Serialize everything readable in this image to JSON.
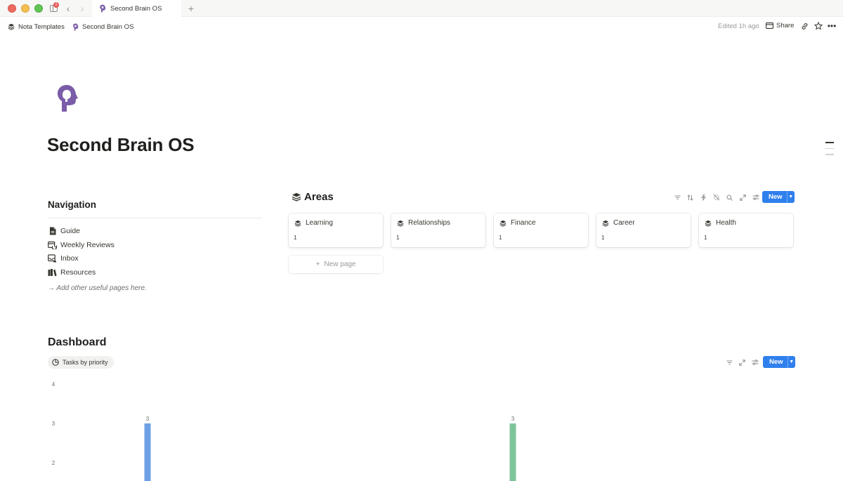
{
  "browser": {
    "tab_title": "Second Brain OS",
    "notification_count": "2"
  },
  "topbar": {
    "breadcrumbs": [
      {
        "label": "Nota Templates",
        "icon": "stack-icon"
      },
      {
        "label": "Second Brain OS",
        "icon": "brain-head-icon"
      }
    ],
    "edited": "Edited 1h ago",
    "share_label": "Share"
  },
  "page": {
    "title": "Second Brain OS",
    "icon": "brain-head-icon",
    "icon_color": "#7b5ca8"
  },
  "navigation": {
    "heading": "Navigation",
    "items": [
      {
        "label": "Guide",
        "icon": "document-icon"
      },
      {
        "label": "Weekly Reviews",
        "icon": "calendar-sync-icon"
      },
      {
        "label": "Inbox",
        "icon": "inbox-icon"
      },
      {
        "label": "Resources",
        "icon": "books-icon"
      }
    ],
    "hint": "→ Add other useful pages here."
  },
  "areas": {
    "heading": "Areas",
    "new_label": "New",
    "cards": [
      {
        "title": "Learning",
        "count": "1"
      },
      {
        "title": "Relationships",
        "count": "1"
      },
      {
        "title": "Finance",
        "count": "1"
      },
      {
        "title": "Career",
        "count": "1"
      },
      {
        "title": "Health",
        "count": "1"
      }
    ],
    "new_page_label": "New page"
  },
  "dashboard": {
    "heading": "Dashboard",
    "view_tab": "Tasks by priority",
    "new_label": "New"
  },
  "colors": {
    "accent": "#2f80ed",
    "bar_blue": "#6ea0e6",
    "bar_green": "#7ec49a"
  },
  "chart_data": {
    "type": "bar",
    "categories": [
      "",
      ""
    ],
    "values": [
      3,
      3
    ],
    "colors": [
      "#6ea0e6",
      "#7ec49a"
    ],
    "y_ticks": [
      4,
      3,
      2
    ],
    "ylim": [
      0,
      4
    ],
    "grid": false
  }
}
